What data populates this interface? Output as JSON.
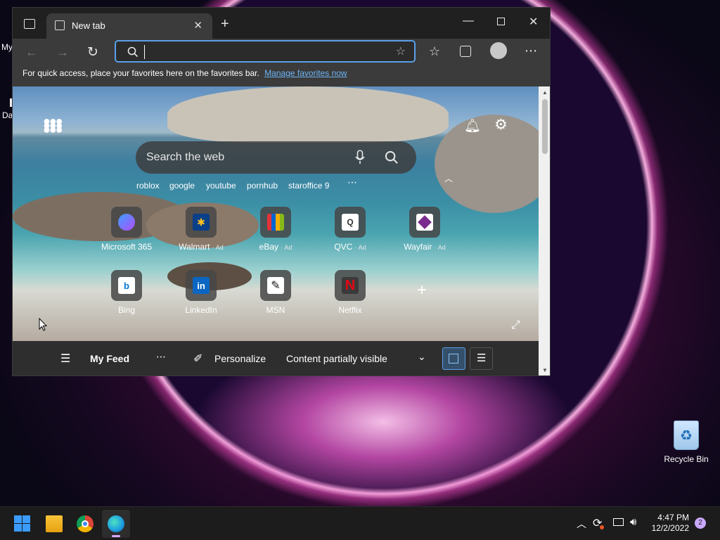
{
  "desktop": {
    "left_labels": [
      "My",
      "Da"
    ],
    "recycle_bin": "Recycle Bin"
  },
  "browser": {
    "tab_title": "New tab",
    "address_placeholder": "",
    "favorites_message": "For quick access, place your favorites here on the favorites bar.",
    "favorites_link": "Manage favorites now"
  },
  "newtab": {
    "search_placeholder": "Search the web",
    "quick_links": [
      "roblox",
      "google",
      "youtube",
      "pornhub",
      "staroffice 9"
    ],
    "tiles_row1": [
      {
        "label": "Microsoft 365",
        "ad": "",
        "color": "#7b5cff"
      },
      {
        "label": "Walmart",
        "ad": "· Ad",
        "color": "#0a3f8a"
      },
      {
        "label": "eBay",
        "ad": "· Ad",
        "color": "#e53238"
      },
      {
        "label": "QVC",
        "ad": "· Ad",
        "color": "#ffffff"
      },
      {
        "label": "Wayfair",
        "ad": "· Ad",
        "color": "#7b2b8f"
      }
    ],
    "tiles_row2": [
      {
        "label": "Bing",
        "color": "#ffffff"
      },
      {
        "label": "LinkedIn",
        "color": "#0a66c2"
      },
      {
        "label": "MSN",
        "color": "#ffffff"
      },
      {
        "label": "Netflix",
        "color": "#e50914"
      }
    ]
  },
  "feed": {
    "my_feed": "My Feed",
    "personalize": "Personalize",
    "content_visibility": "Content partially visible"
  },
  "taskbar": {
    "time": "4:47 PM",
    "date": "12/2/2022",
    "notifications": "2"
  },
  "colors": {
    "accent": "#5aa0e8",
    "link": "#6cb4f5"
  }
}
